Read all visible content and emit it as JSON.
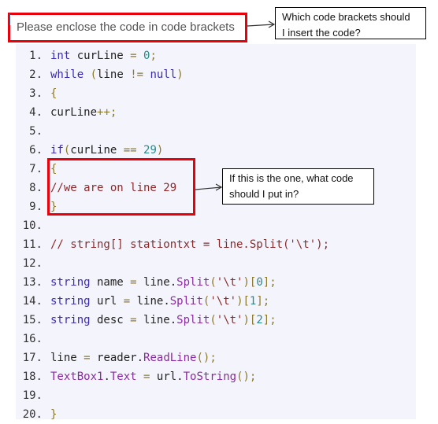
{
  "annotations": {
    "top_note": "Please enclose the code in code brackets",
    "top_callout": [
      "Which code brackets should",
      "I insert the code?"
    ],
    "mid_callout": [
      "If this is the one, what code",
      "should I put in?"
    ]
  },
  "colors": {
    "highlight_red": "#e8000b",
    "panel_bg": "#f4f4fd"
  },
  "code": {
    "lines": [
      {
        "n": "1.",
        "tokens": [
          [
            "kw",
            "int"
          ],
          [
            "id",
            " curLine "
          ],
          [
            "op",
            "="
          ],
          [
            "id",
            " "
          ],
          [
            "num",
            "0"
          ],
          [
            "op",
            ";"
          ]
        ]
      },
      {
        "n": "2.",
        "tokens": [
          [
            "kw",
            "while"
          ],
          [
            "id",
            " "
          ],
          [
            "pn",
            "("
          ],
          [
            "id",
            "line "
          ],
          [
            "op",
            "!="
          ],
          [
            "id",
            " "
          ],
          [
            "kw",
            "null"
          ],
          [
            "pn",
            ")"
          ]
        ]
      },
      {
        "n": "3.",
        "tokens": [
          [
            "pn",
            "{"
          ]
        ]
      },
      {
        "n": "4.",
        "tokens": [
          [
            "id",
            "curLine"
          ],
          [
            "op",
            "++;"
          ]
        ]
      },
      {
        "n": "5.",
        "tokens": []
      },
      {
        "n": "6.",
        "tokens": [
          [
            "kw",
            "if"
          ],
          [
            "pn",
            "("
          ],
          [
            "id",
            "curLine "
          ],
          [
            "op",
            "=="
          ],
          [
            "id",
            " "
          ],
          [
            "num",
            "29"
          ],
          [
            "pn",
            ")"
          ]
        ]
      },
      {
        "n": "7.",
        "tokens": [
          [
            "pn",
            "{"
          ]
        ]
      },
      {
        "n": "8.",
        "tokens": [
          [
            "cm",
            "//we are on line 29"
          ]
        ]
      },
      {
        "n": "9.",
        "tokens": [
          [
            "pn",
            "}"
          ]
        ]
      },
      {
        "n": "10.",
        "tokens": []
      },
      {
        "n": "11.",
        "tokens": [
          [
            "cm",
            "// string[] stationtxt = line.Split('\\t');"
          ]
        ]
      },
      {
        "n": "12.",
        "tokens": []
      },
      {
        "n": "13.",
        "tokens": [
          [
            "kw",
            "string"
          ],
          [
            "id",
            " name "
          ],
          [
            "op",
            "="
          ],
          [
            "id",
            " line."
          ],
          [
            "fn",
            "Split"
          ],
          [
            "pn",
            "("
          ],
          [
            "str",
            "'\\t'"
          ],
          [
            "pn",
            ")["
          ],
          [
            "num",
            "0"
          ],
          [
            "pn",
            "]"
          ],
          [
            "op",
            ";"
          ]
        ]
      },
      {
        "n": "14.",
        "tokens": [
          [
            "kw",
            "string"
          ],
          [
            "id",
            " url "
          ],
          [
            "op",
            "="
          ],
          [
            "id",
            " line."
          ],
          [
            "fn",
            "Split"
          ],
          [
            "pn",
            "("
          ],
          [
            "str",
            "'\\t'"
          ],
          [
            "pn",
            ")["
          ],
          [
            "num",
            "1"
          ],
          [
            "pn",
            "]"
          ],
          [
            "op",
            ";"
          ]
        ]
      },
      {
        "n": "15.",
        "tokens": [
          [
            "kw",
            "string"
          ],
          [
            "id",
            " desc "
          ],
          [
            "op",
            "="
          ],
          [
            "id",
            " line."
          ],
          [
            "fn",
            "Split"
          ],
          [
            "pn",
            "("
          ],
          [
            "str",
            "'\\t'"
          ],
          [
            "pn",
            ")["
          ],
          [
            "num",
            "2"
          ],
          [
            "pn",
            "]"
          ],
          [
            "op",
            ";"
          ]
        ]
      },
      {
        "n": "16.",
        "tokens": []
      },
      {
        "n": "17.",
        "tokens": [
          [
            "id",
            "line "
          ],
          [
            "op",
            "="
          ],
          [
            "id",
            " reader."
          ],
          [
            "fn",
            "ReadLine"
          ],
          [
            "pn",
            "()"
          ],
          [
            "op",
            ";"
          ]
        ]
      },
      {
        "n": "18.",
        "tokens": [
          [
            "fn",
            "TextBox1"
          ],
          [
            "id",
            "."
          ],
          [
            "fn",
            "Text"
          ],
          [
            "id",
            " "
          ],
          [
            "op",
            "="
          ],
          [
            "id",
            " url."
          ],
          [
            "fn",
            "ToString"
          ],
          [
            "pn",
            "()"
          ],
          [
            "op",
            ";"
          ]
        ]
      },
      {
        "n": "19.",
        "tokens": []
      },
      {
        "n": "20.",
        "tokens": [
          [
            "pn",
            "}"
          ]
        ]
      }
    ]
  }
}
